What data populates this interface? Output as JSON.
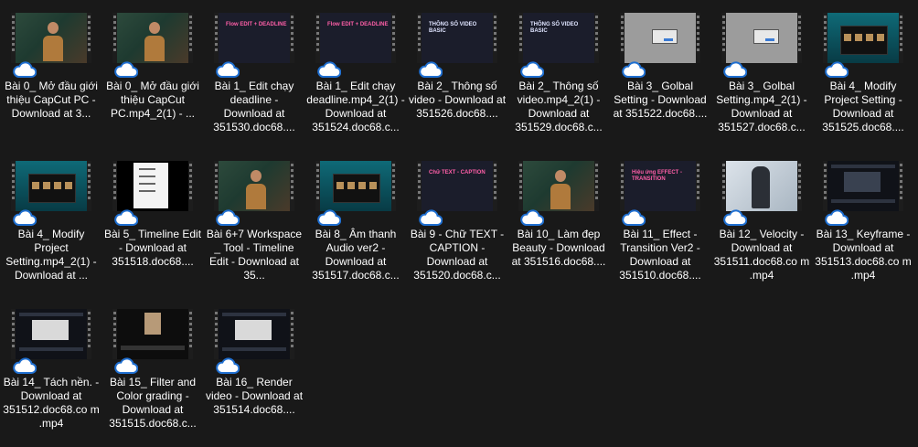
{
  "files": [
    {
      "label": "Bài 0_ Mở đầu giới thiệu CapCut PC - Download at 3...",
      "thumb": "person"
    },
    {
      "label": "Bài 0_ Mở đầu giới thiệu CapCut PC.mp4_2(1) - ...",
      "thumb": "person"
    },
    {
      "label": "Bài 1_ Edit chạy deadline - Download at 351530.doc68....",
      "thumb": "dark",
      "thumb_text": "Flow EDIT + DEADLINE"
    },
    {
      "label": "Bài 1_ Edit chạy deadline.mp4_2(1) - Download at 351524.doc68.c...",
      "thumb": "dark",
      "thumb_text": "Flow EDIT + DEADLINE"
    },
    {
      "label": "Bài 2_ Thông số video - Download at 351526.doc68....",
      "thumb": "dark",
      "thumb_text": "THÔNG SỐ VIDEO BASIC"
    },
    {
      "label": "Bài 2_ Thông số video.mp4_2(1) - Download at 351529.doc68.c...",
      "thumb": "dark",
      "thumb_text": "THÔNG SỐ VIDEO BASIC"
    },
    {
      "label": "Bài 3_ Golbal Setting - Download at 351522.doc68....",
      "thumb": "gray"
    },
    {
      "label": "Bài 3_ Golbal Setting.mp4_2(1) - Download at 351527.doc68.c...",
      "thumb": "gray"
    },
    {
      "label": "Bài 4_ Modify Project Setting - Download at 351525.doc68....",
      "thumb": "teal"
    },
    {
      "label": "Bài 4_ Modify Project Setting.mp4_2(1) - Download at ...",
      "thumb": "teal"
    },
    {
      "label": "Bài 5_ Timeline Edit - Download at 351518.doc68....",
      "thumb": "white"
    },
    {
      "label": "Bài 6+7 Workspace _ Tool - Timeline Edit - Download at 35...",
      "thumb": "person"
    },
    {
      "label": "Bài 8_ Âm thanh Audio ver2 - Download at 351517.doc68.c...",
      "thumb": "teal"
    },
    {
      "label": "Bài 9 - Chữ TEXT - CAPTION - Download at 351520.doc68.c...",
      "thumb": "dark",
      "thumb_text": "Chữ TEXT - CAPTION"
    },
    {
      "label": "Bài 10_ Làm đẹp Beauty - Download at 351516.doc68....",
      "thumb": "person"
    },
    {
      "label": "Bài 11_ Effect - Transition Ver2 - Download at 351510.doc68....",
      "thumb": "dark",
      "thumb_text": "Hiệu ứng EFFECT - TRANSITION"
    },
    {
      "label": "Bài 12_ Velocity - Download at 351511.doc68.co m .mp4",
      "thumb": "photo"
    },
    {
      "label": "Bài 13_ Keyframe - Download at 351513.doc68.co m .mp4",
      "thumb": "editor"
    },
    {
      "label": "Bài 14_ Tách nền. - Download at 351512.doc68.co m .mp4",
      "thumb": "editor-light"
    },
    {
      "label": "Bài 15_ Filter and Color grading - Download at 351515.doc68.c...",
      "thumb": "filter"
    },
    {
      "label": "Bài 16_ Render video - Download at 351514.doc68....",
      "thumb": "editor-light"
    }
  ],
  "icons": {
    "sync_status": "cloud-icon"
  }
}
